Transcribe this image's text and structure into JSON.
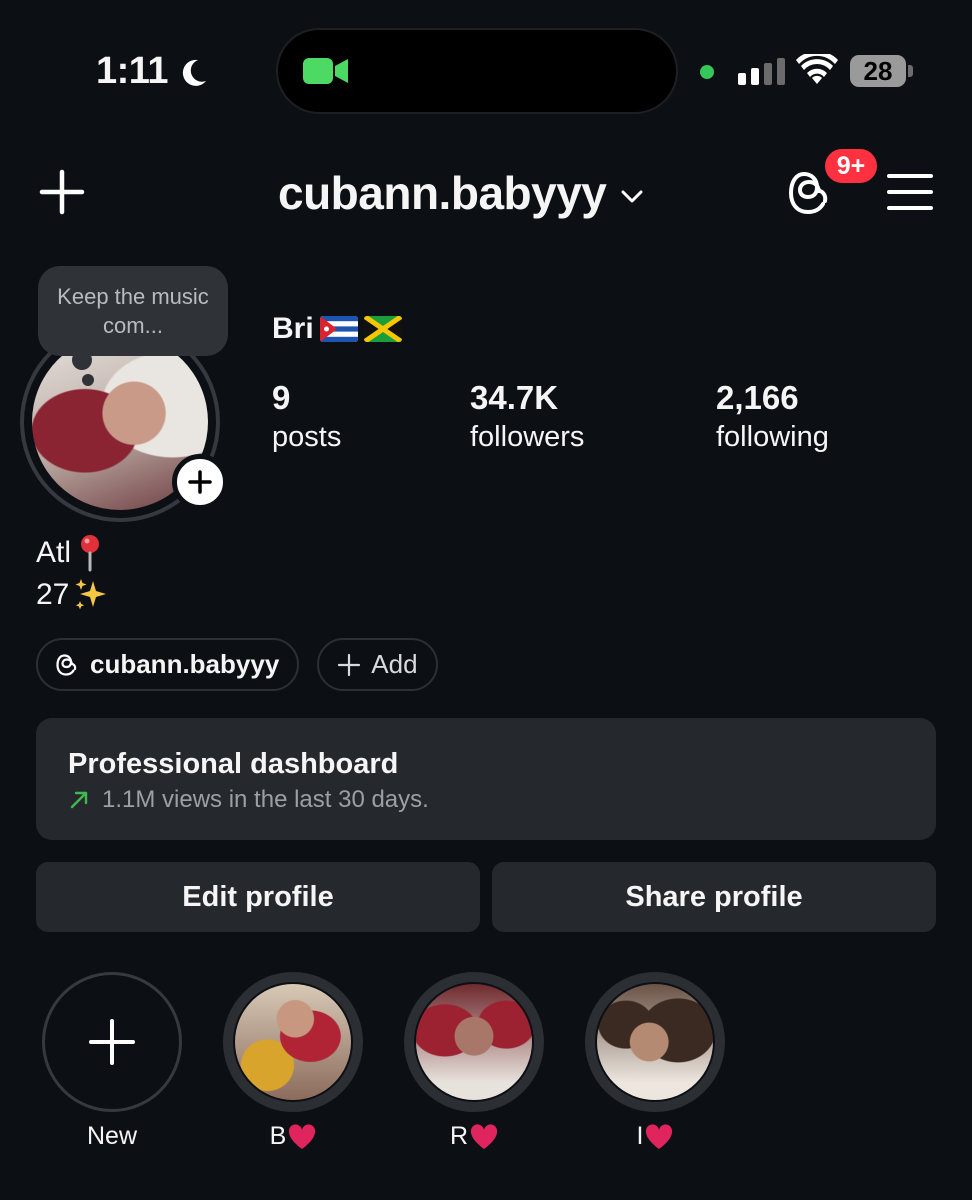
{
  "status_bar": {
    "time": "1:11",
    "battery": "28",
    "icons": [
      "moon-icon",
      "facetime-camera-icon",
      "green-dot-indicator",
      "signal-bars-icon",
      "wifi-icon",
      "battery-icon"
    ]
  },
  "header": {
    "username": "cubann.babyyy",
    "notification_badge": "9+",
    "icons": [
      "plus-icon",
      "chevron-down-icon",
      "threads-icon",
      "menu-icon"
    ]
  },
  "profile": {
    "note_text": "Keep the music com...",
    "display_name": "Bri",
    "flags": [
      "cuba-flag",
      "jamaica-flag"
    ],
    "stats": [
      {
        "value": "9",
        "label": "posts"
      },
      {
        "value": "34.7K",
        "label": "followers"
      },
      {
        "value": "2,166",
        "label": "following"
      }
    ],
    "bio_lines": [
      "Atl",
      "27"
    ],
    "bio_emoji": [
      "round-pushpin-icon",
      "sparkles-icon"
    ]
  },
  "links": {
    "threads_handle": "cubann.babyyy",
    "add_label": "Add"
  },
  "dashboard": {
    "title": "Professional dashboard",
    "subtitle": "1.1M views in the last 30 days.",
    "accent": "#3fb950"
  },
  "buttons": {
    "edit": "Edit profile",
    "share": "Share profile"
  },
  "highlights": [
    {
      "label": "New"
    },
    {
      "label": "B"
    },
    {
      "label": "R"
    },
    {
      "label": "I"
    }
  ],
  "colors": {
    "background": "#0c1014",
    "card": "#25292e",
    "badge": "#ff3040",
    "heart": "#e0245e"
  }
}
